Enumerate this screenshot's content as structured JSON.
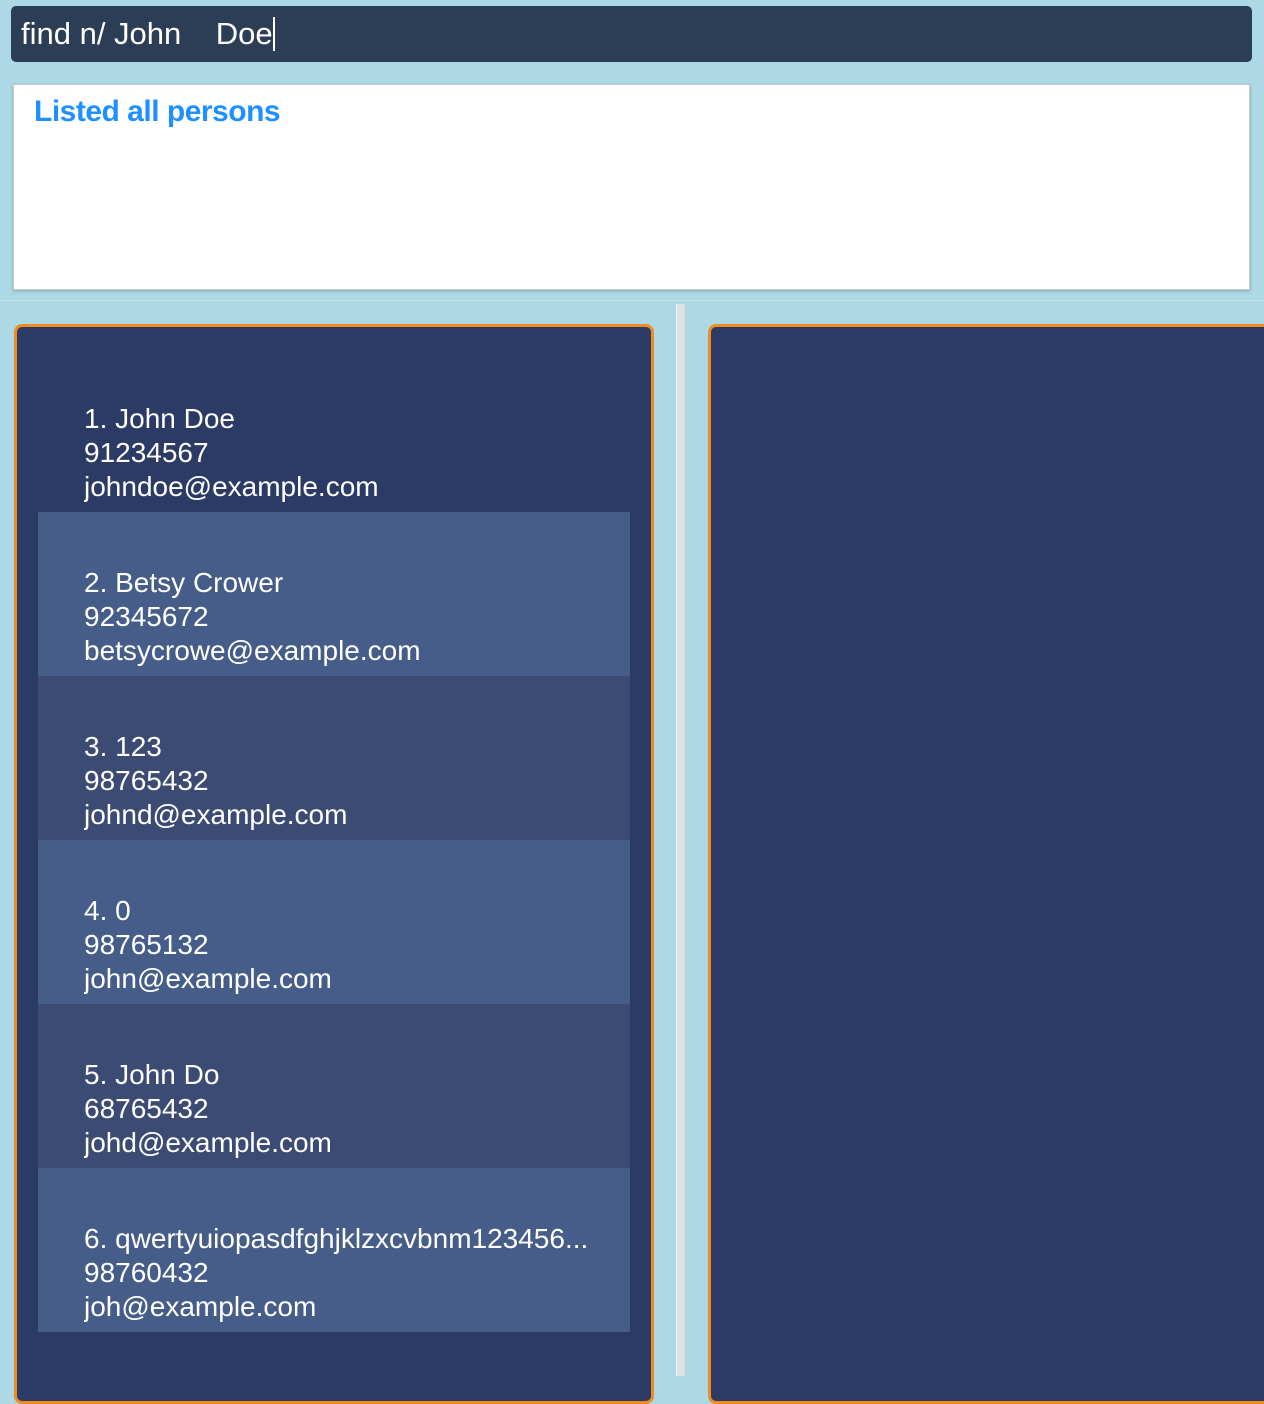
{
  "command_box": {
    "value": "find n/ John    Doe"
  },
  "result_display": {
    "message": "Listed all persons"
  },
  "person_list": {
    "persons": [
      {
        "index_name": "1. John Doe",
        "phone": "91234567",
        "email": "johndoe@example.com"
      },
      {
        "index_name": "2. Betsy Crower",
        "phone": "92345672",
        "email": "betsycrowe@example.com"
      },
      {
        "index_name": "3. 123",
        "phone": "98765432",
        "email": "johnd@example.com"
      },
      {
        "index_name": "4. 0",
        "phone": "98765132",
        "email": "john@example.com"
      },
      {
        "index_name": "5. John Do",
        "phone": "68765432",
        "email": "johd@example.com"
      },
      {
        "index_name": "6. qwertyuiopasdfghjklzxcvbnm123456...",
        "phone": "98760432",
        "email": "joh@example.com"
      }
    ]
  },
  "colors": {
    "background": "#add8e6",
    "command_box": "#2c3e55",
    "result_text": "#1e90ff",
    "panel": "#2c3a66",
    "panel_border": "#f08c1e",
    "card_alt_light": "#455d88",
    "card_alt_dark": "#3b4b74"
  }
}
